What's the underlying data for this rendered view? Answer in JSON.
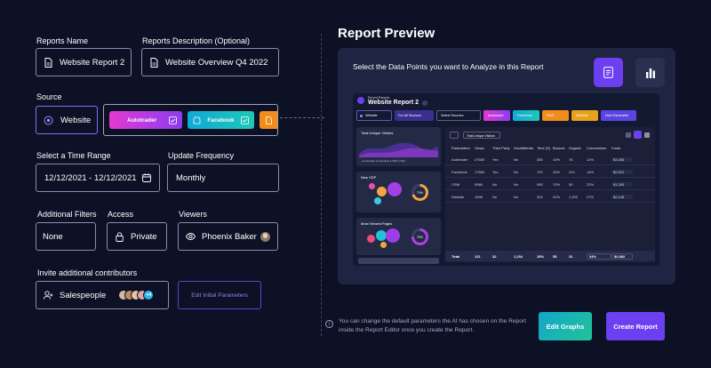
{
  "form": {
    "report_name_label": "Reports Name",
    "report_name_value": "Website Report 2",
    "description_label": "Reports Description (Optional)",
    "description_value": "Website Overview Q4 2022",
    "source_label": "Source",
    "source_value": "Website",
    "source_chips": [
      {
        "name": "Autotrader"
      },
      {
        "name": "Facebook"
      }
    ],
    "time_range_label": "Select a Time Range",
    "time_range_value": "12/12/2021 - 12/12/2021",
    "frequency_label": "Update Frequency",
    "frequency_value": "Monthly",
    "filters_label": "Additional Filters",
    "filters_value": "None",
    "access_label": "Access",
    "access_value": "Private",
    "viewers_label": "Viewers",
    "viewers_value": "Phoenix Baker",
    "invite_label": "Invite additional contributors",
    "invite_value": "Salespeople",
    "invite_count": "+4",
    "edit_params_label": "Edit Initial Parameters"
  },
  "preview": {
    "title": "Report Preview",
    "subtitle": "Select the Data Points you want to Analyze in this Report",
    "dash_caption": "Recent Reports",
    "dash_title": "Website Report 2",
    "dash_source": "Website",
    "dash_sources_all": "For All Sources",
    "dash_select_sources": "Select Sources",
    "dash_chips": [
      "Autotrader",
      "Facebook",
      "SMS",
      "Website"
    ],
    "dash_new_param": "New Parameter",
    "card1_title": "Total Unique Visitors",
    "card1_legend": "● Autotrader  ● Facebook  ● SMS  ● Web",
    "card2_title": "New VDP",
    "card2_pct": "70%",
    "card3_title": "Most Viewed Pages",
    "card3_pct": "75%",
    "table_filter": "Total Unique Visitors",
    "columns": [
      "Parameters",
      "Views",
      "Third Party",
      "SocialMedia",
      "Time (S)",
      "Bounce",
      "Organic",
      "Conversions",
      "Costs"
    ],
    "rows": [
      [
        "Autotrader",
        "27650",
        "Yes",
        "No",
        "380",
        "10%",
        "78",
        "12%",
        "$3,456"
      ],
      [
        "Facebook",
        "17650",
        "Yes",
        "No",
        "720",
        "25%",
        "243",
        "14%",
        "$2,522"
      ],
      [
        "CRM",
        "5986",
        "No",
        "No",
        "980",
        "70%",
        "50",
        "22%",
        "$1,350"
      ],
      [
        "Website",
        "1596",
        "No",
        "No",
        "320",
        "20%",
        "1,200",
        "27%",
        "$2,146"
      ]
    ],
    "total_label": "Total",
    "totals": [
      "121",
      "32",
      "1,234",
      "15%",
      "55",
      "31"
    ],
    "total_conv": "34%",
    "total_cost": "$2,982"
  },
  "footer": {
    "note": "You can change the default parameters the AI has chosen on the Report inside the Report Editor once you create the Report.",
    "edit_graphs": "Edit Graphs",
    "create_report": "Create Report"
  },
  "colors": {
    "bg": "#0d1125",
    "accent": "#7b3ff2",
    "teal": "#0fb6c9",
    "purple": "#5b45e0"
  }
}
